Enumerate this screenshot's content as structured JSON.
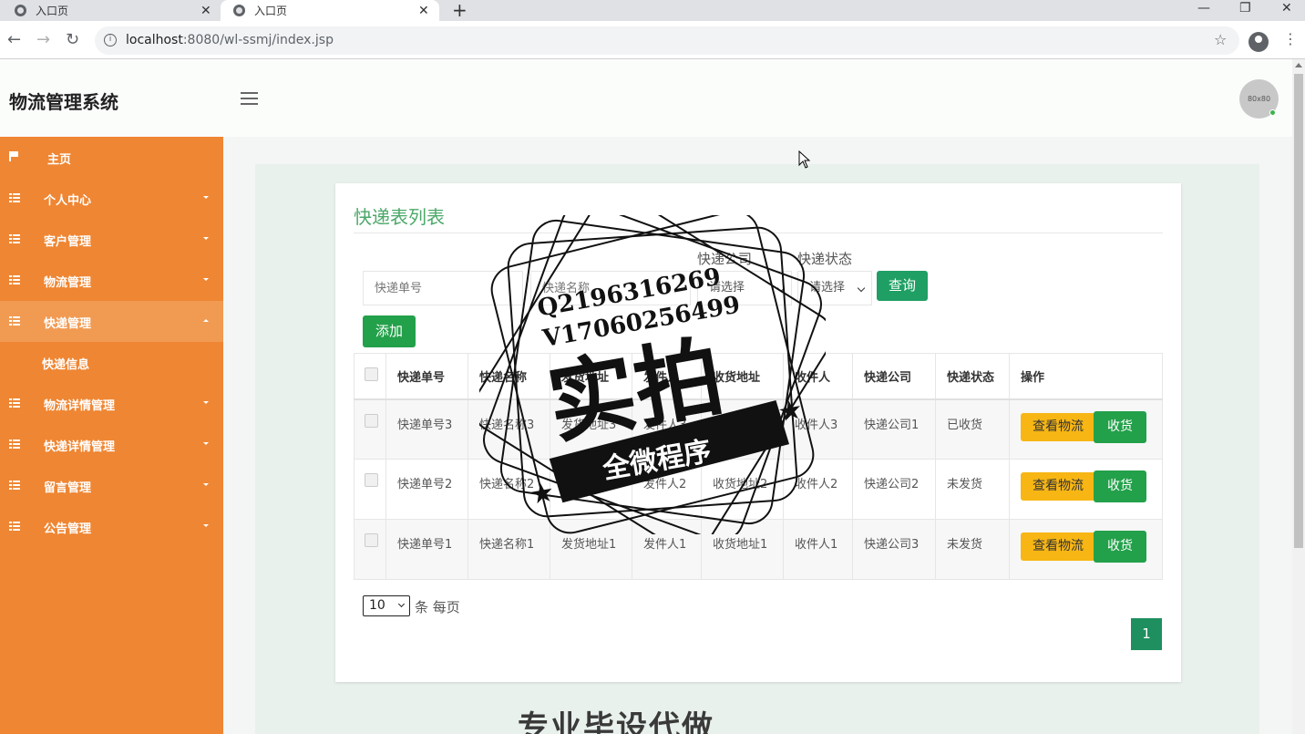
{
  "browser": {
    "tabs": [
      {
        "title": "入口页"
      },
      {
        "title": "入口页"
      }
    ],
    "url_host": "localhost",
    "url_path": ":8080/wl-ssmj/index.jsp"
  },
  "header": {
    "logo": "物流管理系统",
    "avatar_text": "80x80"
  },
  "sidebar": {
    "items": [
      {
        "label": "主页"
      },
      {
        "label": "个人中心"
      },
      {
        "label": "客户管理"
      },
      {
        "label": "物流管理"
      },
      {
        "label": "快递管理"
      },
      {
        "label": "物流详情管理"
      },
      {
        "label": "快递详情管理"
      },
      {
        "label": "留言管理"
      },
      {
        "label": "公告管理"
      }
    ],
    "submenu": {
      "label": "快递信息"
    }
  },
  "panel": {
    "title": "快递表列表",
    "filters": {
      "tracking_placeholder": "快递单号",
      "name_placeholder": "快递名称",
      "company_label": "快递公司",
      "company_value": "请选择",
      "status_label": "快递状态",
      "status_value": "请选择",
      "query_button": "查询",
      "add_button": "添加"
    },
    "table": {
      "headers": [
        "快递单号",
        "快递名称",
        "发货地址",
        "发件人",
        "收货地址",
        "收件人",
        "快递公司",
        "快递状态",
        "操作"
      ],
      "rows": [
        {
          "tracking": "快递单号3",
          "name": "快递名称3",
          "from": "发货地址3",
          "sender": "发件人3",
          "to": "收货地址3",
          "receiver": "收件人3",
          "company": "快递公司1",
          "status": "已收货"
        },
        {
          "tracking": "快递单号2",
          "name": "快递名称2",
          "from": "发货地址2",
          "sender": "发件人2",
          "to": "收货地址2",
          "receiver": "收件人2",
          "company": "快递公司2",
          "status": "未发货"
        },
        {
          "tracking": "快递单号1",
          "name": "快递名称1",
          "from": "发货地址1",
          "sender": "发件人1",
          "to": "收货地址1",
          "receiver": "收件人1",
          "company": "快递公司3",
          "status": "未发货"
        }
      ],
      "view_button": "查看物流",
      "receive_button": "收货"
    },
    "pagination": {
      "page_size": "10",
      "page_size_suffix": "条 每页",
      "current_page": "1"
    }
  },
  "watermark": {
    "line1": "Q2196316269",
    "line2": "V17060256499",
    "main": "实拍",
    "ribbon": "全微程序",
    "bottom": "专业毕设代做"
  },
  "colors": {
    "sidebar": "#ef8633",
    "accent_green": "#23a04a",
    "title_green": "#4ca86a",
    "warning": "#f7b614"
  }
}
